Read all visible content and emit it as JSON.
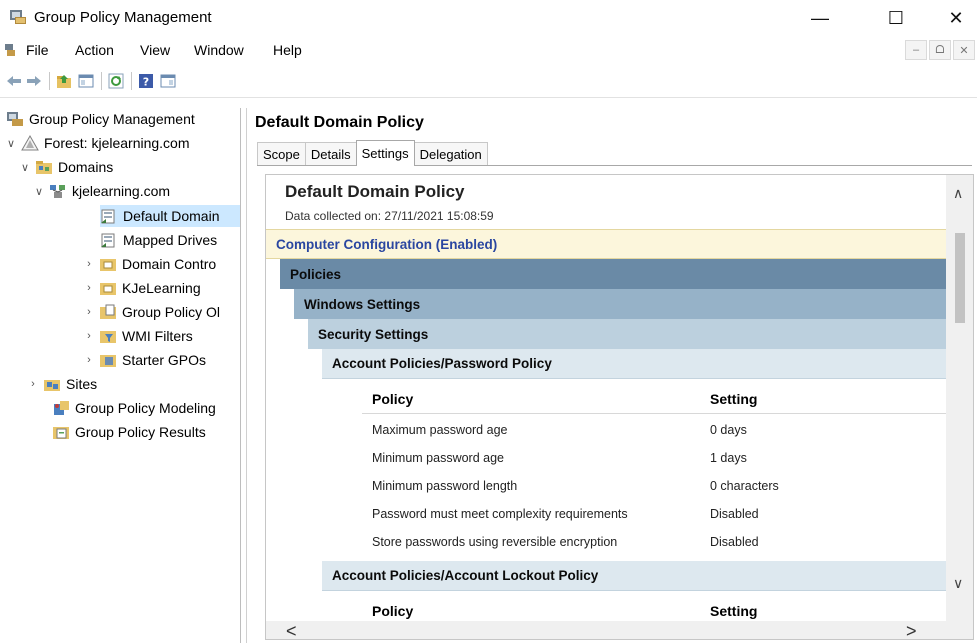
{
  "window": {
    "title": "Group Policy Management",
    "min_glyph": "—",
    "max_glyph": "☐",
    "close_glyph": "✕"
  },
  "menu": {
    "items": [
      "File",
      "Action",
      "View",
      "Window",
      "Help"
    ],
    "mdi": [
      "–",
      "ᗝ",
      "✕"
    ]
  },
  "tree": {
    "items": [
      {
        "label": "Group Policy Management",
        "chevron": "",
        "icon": "gpm-icon"
      },
      {
        "label": "Forest: kjelearning.com",
        "chevron": "∨",
        "icon": "forest-icon"
      },
      {
        "label": "Domains",
        "chevron": "∨",
        "icon": "domains-icon"
      },
      {
        "label": "kjelearning.com",
        "chevron": "∨",
        "icon": "domain-icon"
      },
      {
        "label": "Default Domain",
        "chevron": "",
        "icon": "gpo-link-icon"
      },
      {
        "label": "Mapped Drives",
        "chevron": "",
        "icon": "gpo-link-icon"
      },
      {
        "label": "Domain Contro",
        "chevron": "›",
        "icon": "ou-folder-icon"
      },
      {
        "label": "KJeLearning",
        "chevron": "›",
        "icon": "ou-folder-icon"
      },
      {
        "label": "Group Policy Ol",
        "chevron": "›",
        "icon": "gpo-folder-icon"
      },
      {
        "label": "WMI Filters",
        "chevron": "›",
        "icon": "wmi-filter-icon"
      },
      {
        "label": "Starter GPOs",
        "chevron": "›",
        "icon": "starter-gpo-icon"
      },
      {
        "label": "Sites",
        "chevron": "›",
        "icon": "sites-icon"
      },
      {
        "label": "Group Policy Modeling",
        "chevron": "",
        "icon": "modeling-icon"
      },
      {
        "label": "Group Policy Results",
        "chevron": "",
        "icon": "results-icon"
      }
    ]
  },
  "panel": {
    "title": "Default Domain Policy",
    "tabs": [
      "Scope",
      "Details",
      "Settings",
      "Delegation"
    ],
    "active_tab": "Settings"
  },
  "report": {
    "title": "Default Domain Policy",
    "collected": "Data collected on: 27/11/2021 15:08:59",
    "computer_config": "Computer Configuration (Enabled)",
    "policies": "Policies",
    "windows_settings": "Windows Settings",
    "security_settings": "Security Settings",
    "password_section": "Account Policies/Password Policy",
    "col_policy": "Policy",
    "col_setting": "Setting",
    "password_rows": [
      {
        "policy": "Maximum password age",
        "setting": "0 days"
      },
      {
        "policy": "Minimum password age",
        "setting": "1 days"
      },
      {
        "policy": "Minimum password length",
        "setting": "0 characters"
      },
      {
        "policy": "Password must meet complexity requirements",
        "setting": "Disabled"
      },
      {
        "policy": "Store passwords using reversible encryption",
        "setting": "Disabled"
      }
    ],
    "lockout_section": "Account Policies/Account Lockout Policy",
    "lockout_col_policy": "Policy",
    "lockout_col_setting": "Setting"
  },
  "scroll": {
    "up": "∧",
    "down": "∨",
    "left": "<",
    "right": ">"
  }
}
